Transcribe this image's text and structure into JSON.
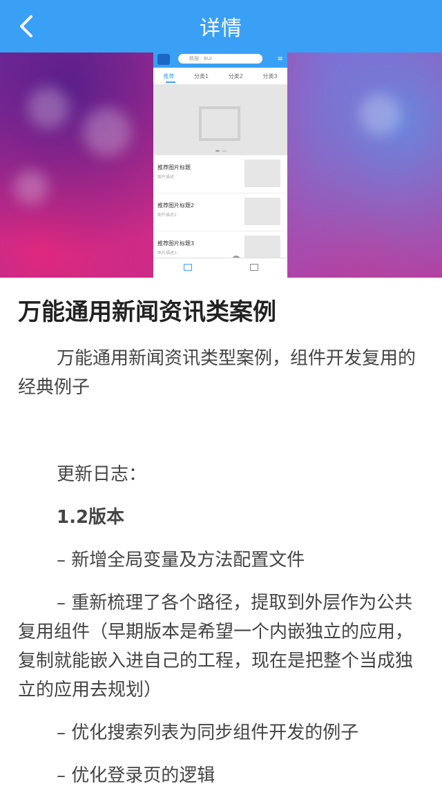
{
  "header": {
    "title": "详情"
  },
  "banner": {
    "search_placeholder": "精搜：BUI",
    "tabs": [
      "推荐",
      "分类1",
      "分类2",
      "分类3"
    ],
    "items": [
      {
        "title": "推荐图片标题",
        "desc": "图片描述"
      },
      {
        "title": "推荐图片标题2",
        "desc": "图片描述2"
      },
      {
        "title": "推荐图片标题3",
        "desc": "图片描述3"
      }
    ]
  },
  "article": {
    "title": "万能通用新闻资讯类案例",
    "intro": "万能通用新闻资讯类型案例，组件开发复用的经典例子",
    "log_heading": "更新日志：",
    "version": "1.2版本",
    "items": [
      "– 新增全局变量及方法配置文件",
      "– 重新梳理了各个路径，提取到外层作为公共复用组件（早期版本是希望一个内嵌独立的应用，复制就能嵌入进自己的工程，现在是把整个当成独立的应用去规划）",
      "– 优化搜索列表为同步组件开发的例子",
      "– 优化登录页的逻辑"
    ]
  }
}
